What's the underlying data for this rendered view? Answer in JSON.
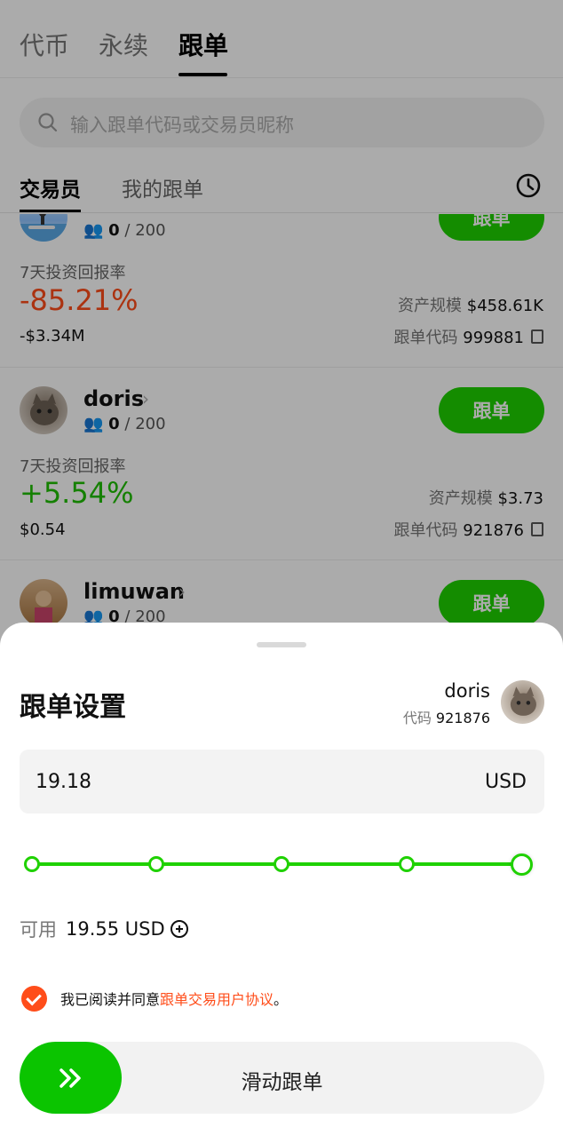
{
  "top_tabs": [
    "代币",
    "永续",
    "跟单"
  ],
  "search": {
    "placeholder": "输入跟单代码或交易员昵称"
  },
  "sub_tabs": [
    "交易员",
    "我的跟单"
  ],
  "traders": [
    {
      "name": "",
      "followers_current": "0",
      "followers_max": "/ 200",
      "follow_label": "跟单",
      "roi_label": "7天投资回报率",
      "roi": "-85.21%",
      "pnl": "-$3.34M",
      "aum_label": "资产规模",
      "aum": "$458.61K",
      "code_label": "跟单代码",
      "code": "999881"
    },
    {
      "name": "doris",
      "followers_current": "0",
      "followers_max": "/ 200",
      "follow_label": "跟单",
      "roi_label": "7天投资回报率",
      "roi": "+5.54%",
      "pnl": "$0.54",
      "aum_label": "资产规模",
      "aum": "$3.73",
      "code_label": "跟单代码",
      "code": "921876"
    },
    {
      "name": "limuwan",
      "followers_current": "0",
      "followers_max": "/ 200",
      "follow_label": "跟单"
    }
  ],
  "sheet": {
    "title": "跟单设置",
    "trader_name": "doris",
    "code_label": "代码",
    "code": "921876",
    "amount": "19.18",
    "unit": "USD",
    "slider_level_percent": 100,
    "available_label": "可用",
    "available_value": "19.55 USD",
    "agree_prefix": "我已阅读并同意",
    "agree_link": "跟单交易用户协议",
    "agree_suffix": "。",
    "slide_label": "滑动跟单"
  },
  "colors": {
    "accent_green": "#1fd100",
    "negative": "#ff4d1a",
    "positive": "#1fbf00"
  }
}
